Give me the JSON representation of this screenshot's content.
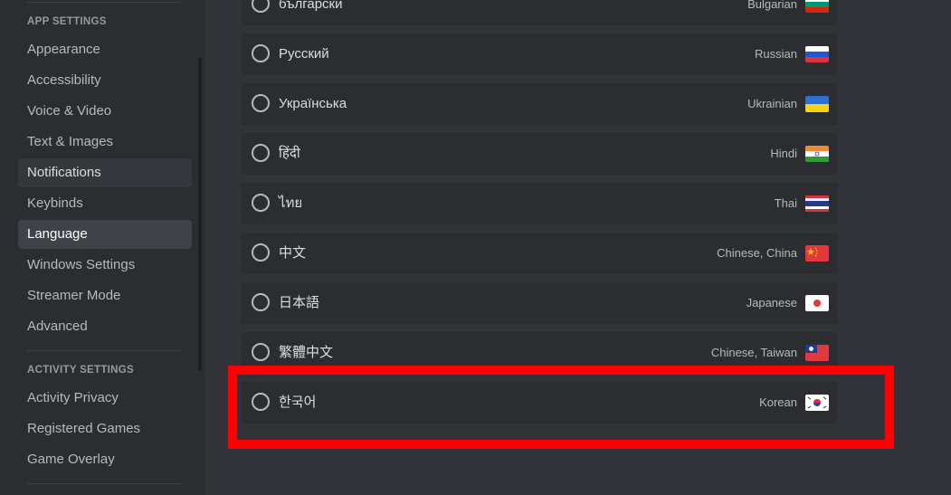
{
  "sidebar": {
    "app_settings_header": "App Settings",
    "app_items": [
      {
        "label": "Appearance"
      },
      {
        "label": "Accessibility"
      },
      {
        "label": "Voice & Video"
      },
      {
        "label": "Text & Images"
      },
      {
        "label": "Notifications"
      },
      {
        "label": "Keybinds"
      },
      {
        "label": "Language"
      },
      {
        "label": "Windows Settings"
      },
      {
        "label": "Streamer Mode"
      },
      {
        "label": "Advanced"
      }
    ],
    "activity_settings_header": "Activity Settings",
    "activity_items": [
      {
        "label": "Activity Privacy"
      },
      {
        "label": "Registered Games"
      },
      {
        "label": "Game Overlay"
      }
    ]
  },
  "languages": [
    {
      "native": "български",
      "english": "Bulgarian",
      "flag_icon": "flag-bulgaria-icon"
    },
    {
      "native": "Русский",
      "english": "Russian",
      "flag_icon": "flag-russia-icon"
    },
    {
      "native": "Українська",
      "english": "Ukrainian",
      "flag_icon": "flag-ukraine-icon"
    },
    {
      "native": "हिंदी",
      "english": "Hindi",
      "flag_icon": "flag-india-icon"
    },
    {
      "native": "ไทย",
      "english": "Thai",
      "flag_icon": "flag-thailand-icon"
    },
    {
      "native": "中文",
      "english": "Chinese, China",
      "flag_icon": "flag-china-icon"
    },
    {
      "native": "日本語",
      "english": "Japanese",
      "flag_icon": "flag-japan-icon"
    },
    {
      "native": "繁體中文",
      "english": "Chinese, Taiwan",
      "flag_icon": "flag-taiwan-icon"
    },
    {
      "native": "한국어",
      "english": "Korean",
      "flag_icon": "flag-korea-icon"
    }
  ],
  "colors": {
    "background": "#313338",
    "sidebar": "#2b2d31",
    "row": "#2b2d31",
    "highlight": "#ff0000"
  }
}
